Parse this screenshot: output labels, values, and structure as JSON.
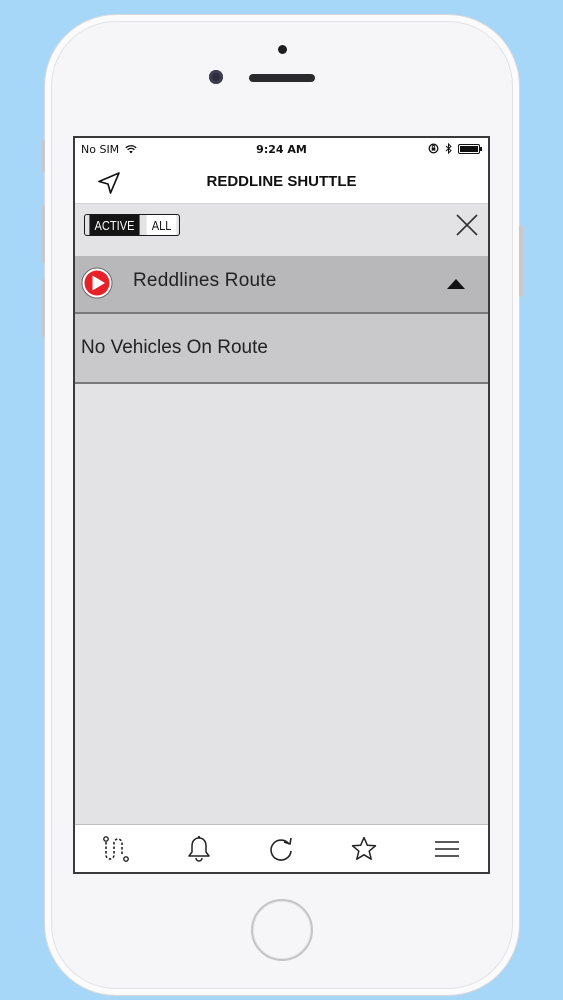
{
  "status_bar": {
    "carrier": "No SIM",
    "time": "9:24 AM"
  },
  "nav": {
    "title": "REDDLINE SHUTTLE",
    "location_icon": "location-arrow-icon"
  },
  "filter": {
    "active_label": "ACTIVE",
    "all_label": "ALL",
    "selected": "ACTIVE",
    "close_icon": "close-icon"
  },
  "route": {
    "name": "Reddlines Route",
    "icon": "play-circle-icon",
    "expanded": true,
    "accent": "#e8202a"
  },
  "vehicles": {
    "empty_text": "No Vehicles On Route"
  },
  "tabbar": {
    "items": [
      {
        "icon": "route-icon"
      },
      {
        "icon": "bell-icon"
      },
      {
        "icon": "refresh-icon"
      },
      {
        "icon": "star-icon"
      },
      {
        "icon": "menu-icon"
      }
    ]
  },
  "colors": {
    "background": "#a6d6f8",
    "route_row": "#b8b8ba",
    "list_bg": "#e3e3e5"
  }
}
